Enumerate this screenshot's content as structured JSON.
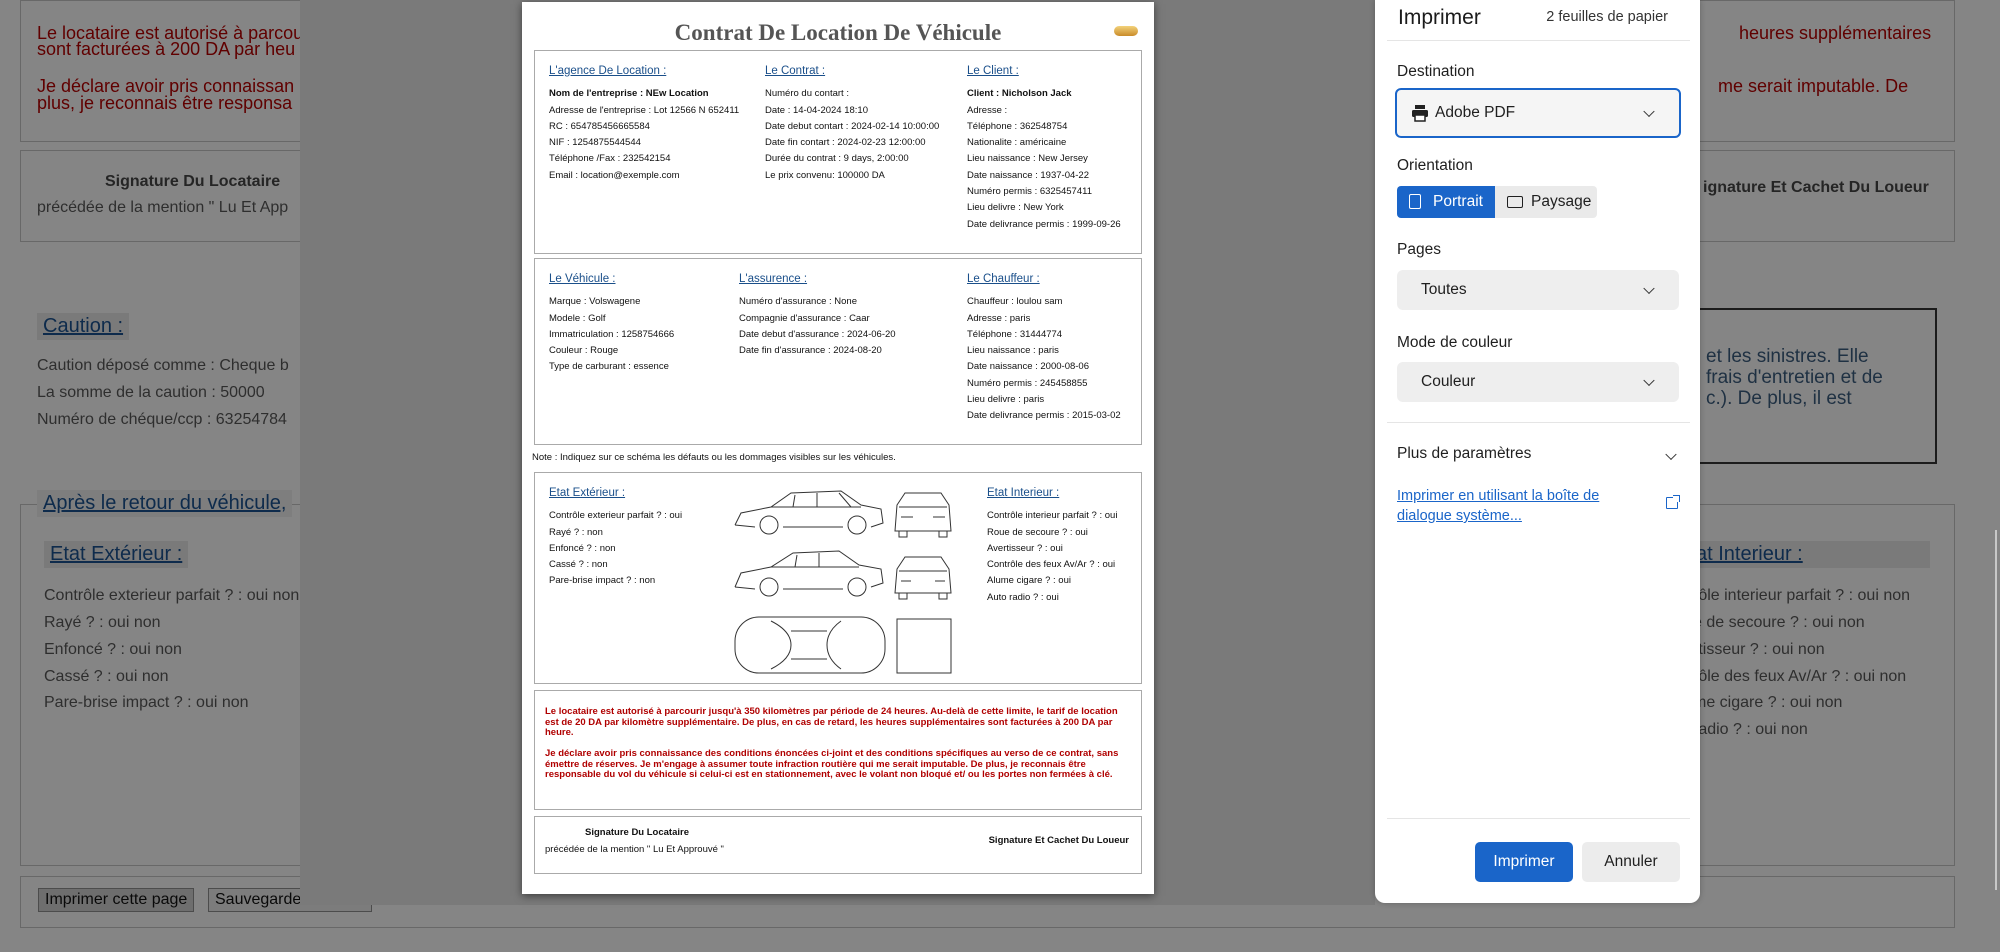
{
  "background": {
    "red_para1": [
      "Le locataire est autorisé à parcou",
      "sont facturées à 200 DA par heu"
    ],
    "red_para2": [
      "Je déclare avoir pris connaissan",
      "plus, je reconnais être responsa"
    ],
    "red_right1": "heures supplémentaires",
    "red_right2": "me serait imputable. De",
    "sig_left_title": "Signature Du Locataire",
    "sig_left_sub": "précédée de la mention \" Lu Et App",
    "sig_right": "ignature Et Cachet Du Loueur",
    "caution_head": "Caution :",
    "caution_lines": [
      "Caution déposé comme : Cheque b",
      "La somme de la caution : 50000",
      "Numéro de chéque/ccp : 63254784"
    ],
    "right_box_lines": [
      "et les sinistres. Elle",
      "frais d'entretien et de",
      "c.). De plus, il est"
    ],
    "apres_head": "Après le retour du véhicule,",
    "ext_head": "Etat Extérieur :",
    "ext_lines": [
      "Contrôle exterieur parfait ? : oui non",
      "Rayé ? : oui non",
      "Enfoncé ? : oui non",
      "Cassé ? : oui non",
      "Pare-brise impact ? : oui non"
    ],
    "int_head": "at Interieur :",
    "int_lines": [
      "rôle interieur parfait ? : oui non",
      "e de secoure ? : oui non",
      "rtisseur ? : oui non",
      "rôle des feux Av/Ar ? : oui non",
      "me cigare ? : oui non",
      "radio ? : oui non"
    ],
    "btn_print": "Imprimer cette page",
    "btn_save": "Sauvegarder en PDF"
  },
  "sheet": {
    "title": "Contrat De Location De Véhicule",
    "agence": {
      "head": "L'agence De Location :",
      "lines": [
        "Nom de l'entreprise : NEw Location",
        "Adresse de l'entreprise : Lot 12566 N 652411",
        "RC : 654785456665584",
        "NIF : 1254875544544",
        "Téléphone /Fax : 232542154",
        "Email : location@exemple.com"
      ]
    },
    "contrat": {
      "head": "Le Contrat :",
      "lines": [
        "Numéro du contart :",
        "Date : 14-04-2024 18:10",
        "Date debut contart : 2024-02-14 10:00:00",
        "Date fin contart : 2024-02-23 12:00:00",
        "Durée du contrat : 9 days, 2:00:00",
        "Le prix convenu: 100000 DA"
      ]
    },
    "client": {
      "head": "Le Client :",
      "lines": [
        "Client : Nicholson Jack",
        "Adresse :",
        "Téléphone : 362548754",
        "Nationalite : américaine",
        "Lieu naissance : New Jersey",
        "Date naissance : 1937-04-22",
        "Numéro permis : 6325457411",
        "Lieu delivre : New York",
        "Date delivrance permis : 1999-09-26"
      ]
    },
    "vehicule": {
      "head": "Le Véhicule :",
      "lines": [
        "Marque : Volswagene",
        "Modele : Golf",
        "Immatriculation : 1258754666",
        "Couleur : Rouge",
        "Type de carburant : essence"
      ]
    },
    "assurance": {
      "head": "L'assurence :",
      "lines": [
        "Numéro d'assurance : None",
        "Compagnie d'assurance : Caar",
        "Date debut d'assurance : 2024-06-20",
        "Date fin d'assurance : 2024-08-20"
      ]
    },
    "chauffeur": {
      "head": "Le Chauffeur :",
      "lines": [
        "Chauffeur : loulou sam",
        "Adresse : paris",
        "Téléphone : 31444774",
        "Lieu naissance : paris",
        "Date naissance : 2000-08-06",
        "Numéro permis : 245458855",
        "Lieu delivre : paris",
        "Date delivrance permis : 2015-03-02"
      ]
    },
    "note": "Note : Indiquez sur ce schéma les défauts ou les dommages visibles sur les véhicules.",
    "ext": {
      "head": "Etat Extérieur :",
      "lines": [
        "Contrôle exterieur parfait ? : oui",
        "Rayé ? : non",
        "Enfoncé ? : non",
        "Cassé ? : non",
        "Pare-brise impact ? : non"
      ]
    },
    "int": {
      "head": "Etat Interieur :",
      "lines": [
        "Contrôle interieur parfait ? : oui",
        "Roue de secoure ? : oui",
        "Avertisseur ? : oui",
        "Contrôle des feux Av/Ar ? : oui",
        "Alume cigare ? : oui",
        "Auto radio ? : oui"
      ]
    },
    "terms1": "Le locataire est autorisé à parcourir jusqu'à 350 kilomètres par période de 24 heures. Au-delà de cette limite, le tarif de location est de 20 DA par kilomètre supplémentaire. De plus, en cas de retard, les heures supplémentaires sont facturées à 200 DA par heure.",
    "terms2": "Je déclare avoir pris connaissance des conditions énoncées ci-joint et des conditions spécifiques au verso de ce contrat, sans émettre de réserves. Je m'engage à assumer toute infraction routière qui me serait imputable. De plus, je reconnais être responsable du vol du véhicule si celui-ci est en stationnement, avec le volant non bloqué et/ ou les portes non fermées à clé.",
    "sig_left_title": "Signature Du Locataire",
    "sig_left_sub": "précédée de la mention \" Lu Et Approuvé \"",
    "sig_right": "Signature Et Cachet Du Loueur"
  },
  "dialog": {
    "title": "Imprimer",
    "sheets": "2 feuilles de papier",
    "destination_label": "Destination",
    "destination_value": "Adobe PDF",
    "orientation_label": "Orientation",
    "portrait": "Portrait",
    "paysage": "Paysage",
    "pages_label": "Pages",
    "pages_value": "Toutes",
    "color_label": "Mode de couleur",
    "color_value": "Couleur",
    "more_settings": "Plus de paramètres",
    "system_dialog_link": "Imprimer en utilisant la boîte de dialogue système...",
    "print_btn": "Imprimer",
    "cancel_btn": "Annuler"
  },
  "colors": {
    "accent": "#1a65c9",
    "terms_red": "#b00000",
    "link_blue": "#1a4f8a"
  }
}
